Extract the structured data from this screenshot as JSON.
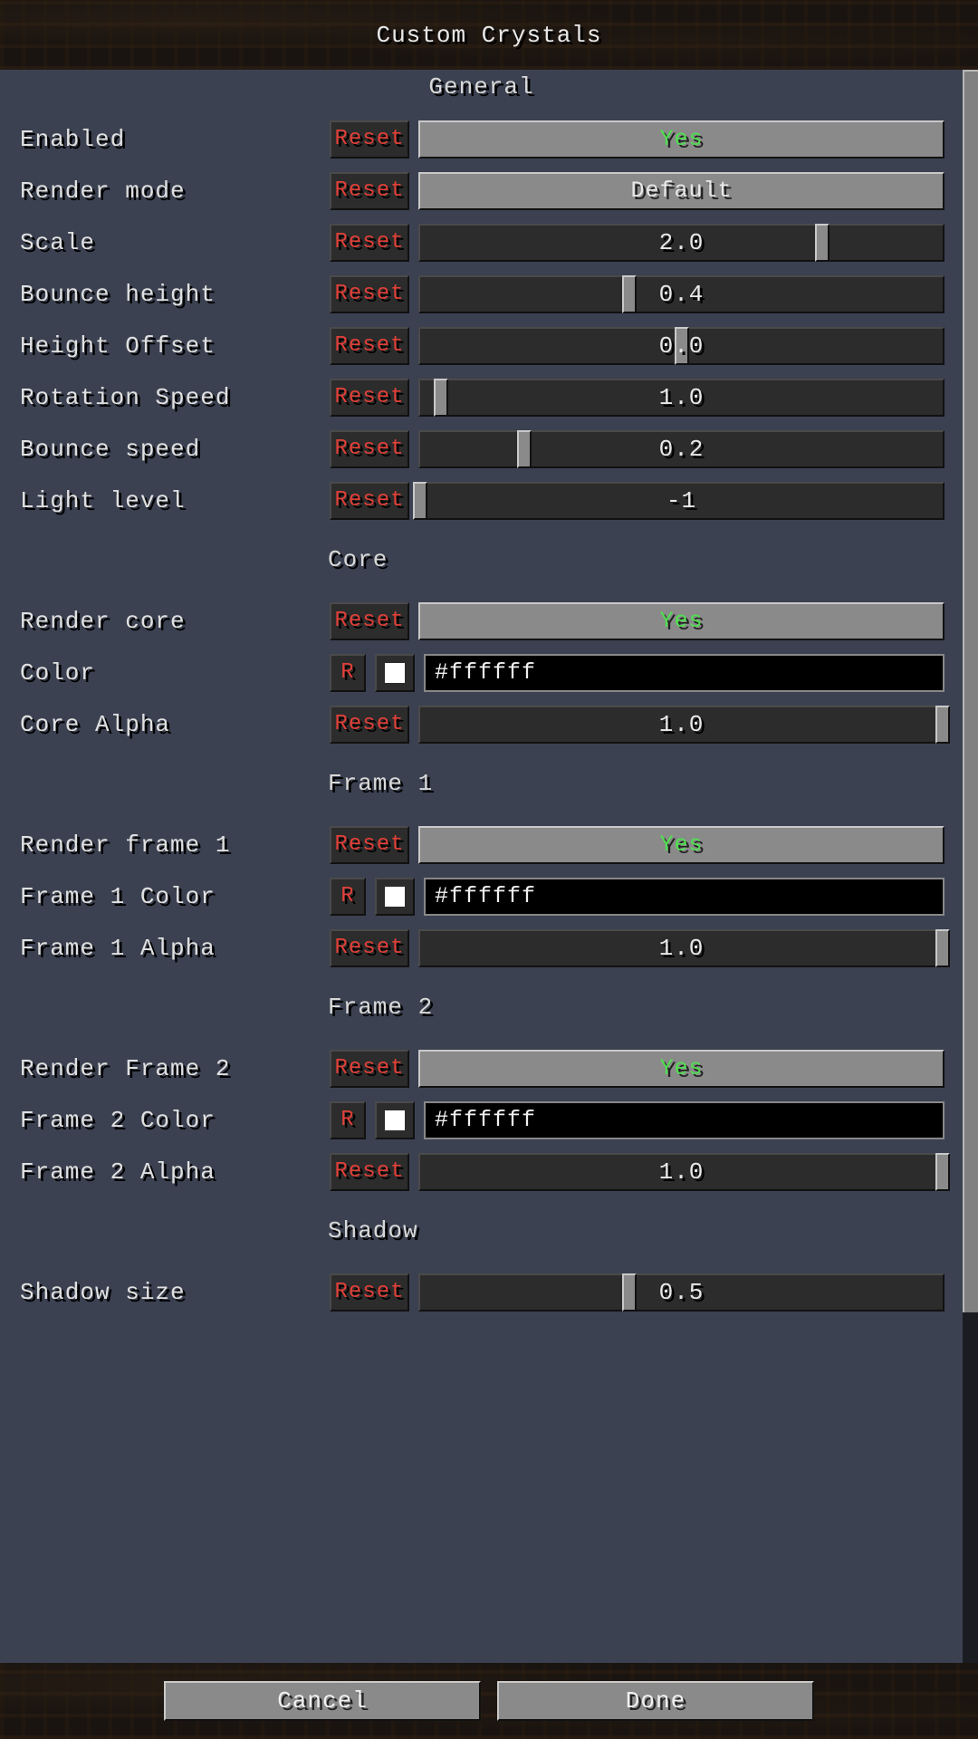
{
  "title": "Custom Crystals",
  "reset_label": "Reset",
  "reset_short": "R",
  "sections": {
    "general": {
      "header": "General",
      "enabled": {
        "label": "Enabled",
        "value": "Yes"
      },
      "render_mode": {
        "label": "Render mode",
        "value": "Default"
      },
      "scale": {
        "label": "Scale",
        "value": "2.0",
        "pos": 0.77
      },
      "bounce_height": {
        "label": "Bounce height",
        "value": "0.4",
        "pos": 0.4
      },
      "height_offset": {
        "label": "Height Offset",
        "value": "0.0",
        "pos": 0.5
      },
      "rotation_speed": {
        "label": "Rotation Speed",
        "value": "1.0",
        "pos": 0.04
      },
      "bounce_speed": {
        "label": "Bounce speed",
        "value": "0.2",
        "pos": 0.2
      },
      "light_level": {
        "label": "Light level",
        "value": "-1",
        "pos": 0.0
      }
    },
    "core": {
      "header": "Core",
      "render_core": {
        "label": "Render core",
        "value": "Yes"
      },
      "color": {
        "label": "Color",
        "value": "#ffffff",
        "swatch": "#ffffff"
      },
      "core_alpha": {
        "label": "Core Alpha",
        "value": "1.0",
        "pos": 1.0
      }
    },
    "frame1": {
      "header": "Frame 1",
      "render": {
        "label": "Render frame 1",
        "value": "Yes"
      },
      "color": {
        "label": "Frame 1 Color",
        "value": "#ffffff",
        "swatch": "#ffffff"
      },
      "alpha": {
        "label": "Frame 1 Alpha",
        "value": "1.0",
        "pos": 1.0
      }
    },
    "frame2": {
      "header": "Frame 2",
      "render": {
        "label": "Render Frame 2",
        "value": "Yes"
      },
      "color": {
        "label": "Frame 2 Color",
        "value": "#ffffff",
        "swatch": "#ffffff"
      },
      "alpha": {
        "label": "Frame 2 Alpha",
        "value": "1.0",
        "pos": 1.0
      }
    },
    "shadow": {
      "header": "Shadow",
      "size": {
        "label": "Shadow size",
        "value": "0.5",
        "pos": 0.4
      }
    }
  },
  "footer": {
    "cancel": "Cancel",
    "done": "Done"
  }
}
